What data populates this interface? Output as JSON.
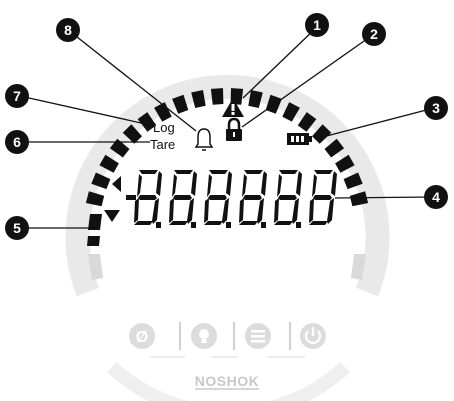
{
  "lcd": {
    "log_label": "Log",
    "tare_label": "Tare"
  },
  "callouts": [
    "1",
    "2",
    "3",
    "4",
    "5",
    "6",
    "7",
    "8"
  ],
  "brand": {
    "logo_text": "NOSHOK"
  },
  "icons": {
    "warning": "warning-triangle-icon",
    "lock": "padlock-icon",
    "bell": "bell-icon",
    "battery": "battery-icon",
    "zero": "zero-button-icon",
    "light": "backlight-button-icon",
    "menu": "menu-button-icon",
    "power": "power-button-icon"
  },
  "colors": {
    "segment": "#111111",
    "ring": "#e6e6e6",
    "button": "#dcdcdc",
    "callout": "#111111"
  }
}
